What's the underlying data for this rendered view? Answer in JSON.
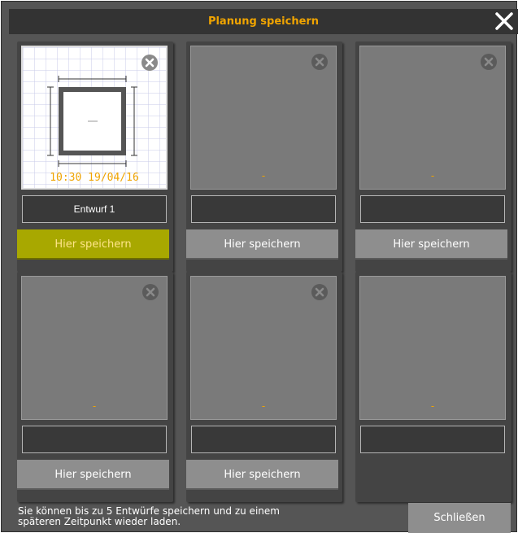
{
  "dialog": {
    "title": "Planung speichern",
    "close_icon": "close-x-icon",
    "accent_color": "#f0a400"
  },
  "slots": [
    {
      "name": "Entwurf 1",
      "timestamp": "10:30 19/04/16",
      "placeholder": "-",
      "save_label": "Hier speichern",
      "has_delete": true,
      "active": true,
      "has_save": true
    },
    {
      "name": "",
      "timestamp": "",
      "placeholder": "-",
      "save_label": "Hier speichern",
      "has_delete": true,
      "active": false,
      "has_save": true
    },
    {
      "name": "",
      "timestamp": "",
      "placeholder": "-",
      "save_label": "Hier speichern",
      "has_delete": true,
      "active": false,
      "has_save": true
    },
    {
      "name": "",
      "timestamp": "",
      "placeholder": "-",
      "save_label": "Hier speichern",
      "has_delete": true,
      "active": false,
      "has_save": true
    },
    {
      "name": "",
      "timestamp": "",
      "placeholder": "-",
      "save_label": "Hier speichern",
      "has_delete": true,
      "active": false,
      "has_save": true
    },
    {
      "name": "",
      "timestamp": "",
      "placeholder": "-",
      "save_label": "",
      "has_delete": false,
      "active": false,
      "has_save": false
    }
  ],
  "footer": {
    "line1": "Sie können bis zu 5 Entwürfe speichern und zu einem",
    "line2": "späteren Zeitpunkt wieder laden.",
    "close_label": "Schließen"
  }
}
